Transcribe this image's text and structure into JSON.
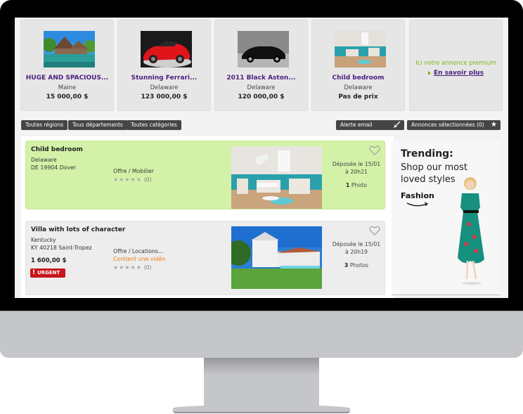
{
  "featured": [
    {
      "title": "HUGE AND SPACIOUS...",
      "region": "Maine",
      "price": "15 000,00 $",
      "image": "villa-pool-photo"
    },
    {
      "title": "Stunning Ferrari...",
      "region": "Delaware",
      "price": "123 000,00 $",
      "image": "red-ferrari-photo"
    },
    {
      "title": "2011 Black Aston...",
      "region": "Delaware",
      "price": "120 000,00 $",
      "image": "black-aston-photo"
    },
    {
      "title": "Child bedroom",
      "region": "Delaware",
      "price": "Pas de prix",
      "image": "child-bedroom-photo"
    }
  ],
  "premium": {
    "text": "Ici votre annonce premium",
    "link": "En savoir plus"
  },
  "filters": {
    "regions": "Toutes régions",
    "departments": "Tous départements",
    "categories": "Toutes catégories",
    "email_alert": "Alerte email",
    "email_alert_icon": "broom-icon",
    "selected": "Annonces sélectionnées (0)",
    "selected_icon": "star-icon"
  },
  "listings": [
    {
      "title": "Child bedroom",
      "region": "Delaware",
      "address": "DE 19904 Dover",
      "category": "Offre / Mobilier",
      "rating_count": "(0)",
      "date_line1": "Déposée le 15/01",
      "date_line2": "à 20h21",
      "photo_count": "1",
      "photo_label": "Photo",
      "highlighted": true
    },
    {
      "title": "Villa with lots of character",
      "region": "Kentucky",
      "address": "KY 40218 Saint-Tropez",
      "price": "1 600,00 $",
      "badge": "URGENT",
      "category": "Offre / Locations...",
      "video": "Contient une vidéo",
      "rating_count": "(0)",
      "date_line1": "Déposée le 15/01",
      "date_line2": "à 20h19",
      "photo_count": "3",
      "photo_label": "Photos",
      "highlighted": false
    }
  ],
  "ad": {
    "headline": "Trending:",
    "subline": "Shop our most loved styles",
    "brand": "Fashion"
  },
  "colors": {
    "link_purple": "#4b1e7e",
    "premium_green": "#7cb51c",
    "highlight_bg": "#d3f2a8",
    "urgent_red": "#c8161d",
    "video_orange": "#f07b12",
    "button_dark": "#454545"
  }
}
